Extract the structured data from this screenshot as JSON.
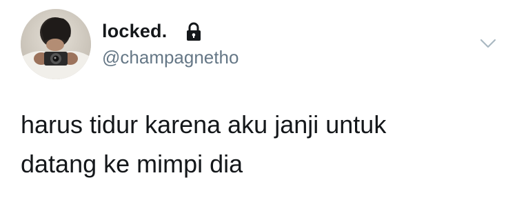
{
  "tweet": {
    "display_name": "locked.",
    "handle": "@champagnetho",
    "text_line1": "harus tidur karena aku janji untuk",
    "text_line2": "datang ke mimpi dia",
    "protected_icon": "lock-icon",
    "menu_icon": "chevron-down-icon"
  },
  "colors": {
    "text": "#14171a",
    "secondary": "#657786",
    "chevron": "#aab8c2",
    "background": "#ffffff"
  }
}
